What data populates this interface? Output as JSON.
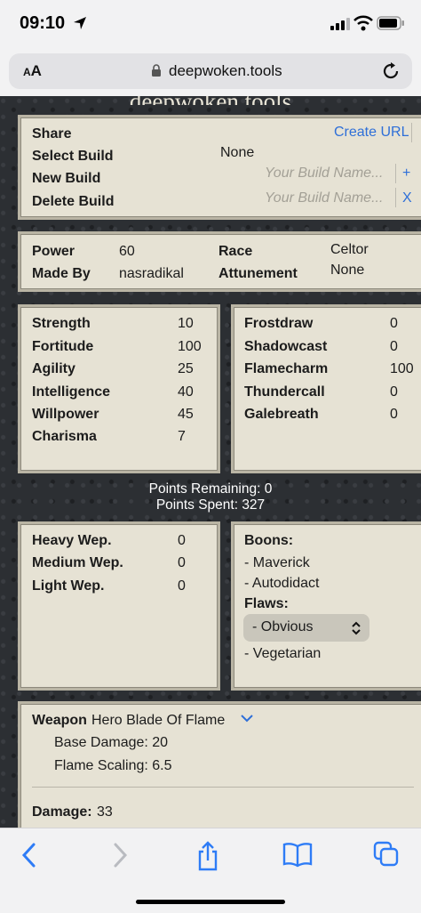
{
  "status_bar": {
    "time": "09:10"
  },
  "browser": {
    "text_size_label": "AA",
    "url": "deepwoken.tools"
  },
  "site": {
    "title": "deepwoken.tools"
  },
  "build": {
    "share_label": "Share",
    "create_url": "Create URL",
    "select_label": "Select Build",
    "select_value": "None",
    "new_label": "New Build",
    "new_placeholder": "Your Build Name...",
    "new_action": "+",
    "delete_label": "Delete Build",
    "delete_placeholder": "Your Build Name...",
    "delete_action": "X"
  },
  "info": {
    "power_label": "Power",
    "power_value": "60",
    "race_label": "Race",
    "race_value": "Celtor",
    "madeby_label": "Made By",
    "madeby_value": "nasradikal",
    "attunement_label": "Attunement",
    "attunement_value": "None"
  },
  "stats": [
    {
      "name": "Strength",
      "value": "10"
    },
    {
      "name": "Fortitude",
      "value": "100"
    },
    {
      "name": "Agility",
      "value": "25"
    },
    {
      "name": "Intelligence",
      "value": "40"
    },
    {
      "name": "Willpower",
      "value": "45"
    },
    {
      "name": "Charisma",
      "value": "7"
    }
  ],
  "attunements": [
    {
      "name": "Frostdraw",
      "value": "0"
    },
    {
      "name": "Shadowcast",
      "value": "0"
    },
    {
      "name": "Flamecharm",
      "value": "100"
    },
    {
      "name": "Thundercall",
      "value": "0"
    },
    {
      "name": "Galebreath",
      "value": "0"
    }
  ],
  "points": {
    "remaining": "Points Remaining: 0",
    "spent": "Points Spent: 327"
  },
  "weapons": [
    {
      "name": "Heavy Wep.",
      "value": "0"
    },
    {
      "name": "Medium Wep.",
      "value": "0"
    },
    {
      "name": "Light Wep.",
      "value": "0"
    }
  ],
  "traits": {
    "boons_label": "Boons:",
    "boons": [
      "- Maverick",
      "- Autodidact"
    ],
    "flaws_label": "Flaws:",
    "flaw_select": "- Obvious",
    "flaws_extra": [
      "- Vegetarian"
    ]
  },
  "weapon": {
    "label": "Weapon",
    "name": "Hero Blade Of Flame",
    "base_damage": "Base Damage: 20",
    "flame_scaling": "Flame Scaling: 6.5",
    "damage_label": "Damage:",
    "damage_value": "33"
  },
  "colors": {
    "panel": "#e6e2d4",
    "link": "#2e6fd8",
    "page_bg": "#2c2f33"
  }
}
